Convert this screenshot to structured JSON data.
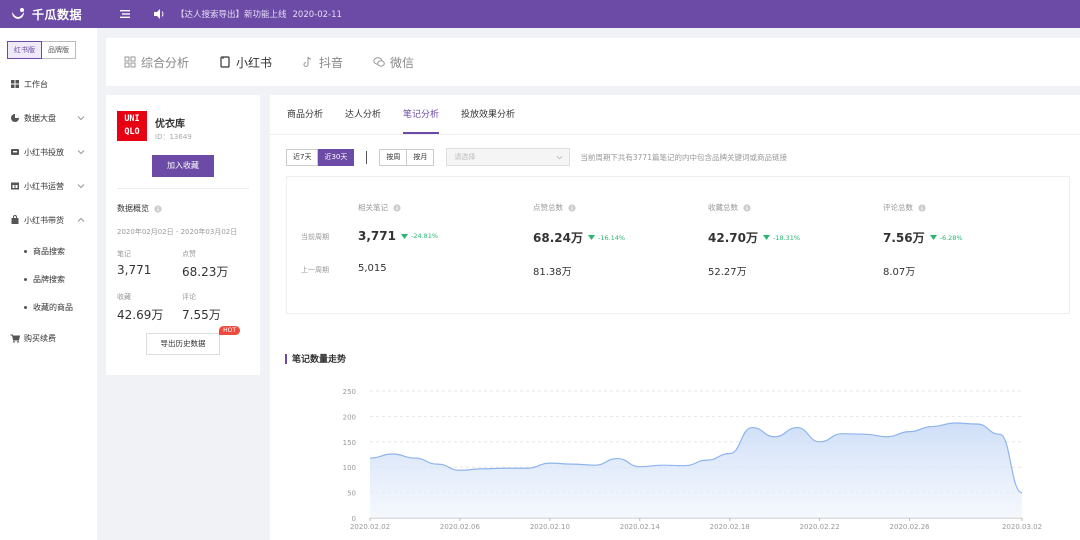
{
  "header": {
    "app_name": "千瓜数据",
    "notice": "【达人搜索导出】新功能上线",
    "notice_date": "2020-02-11"
  },
  "sidebar": {
    "version_tabs": [
      "红书版",
      "品牌版"
    ],
    "items": [
      {
        "label": "工作台",
        "icon": "grid-icon"
      },
      {
        "label": "数据大盘",
        "icon": "chart-circle-icon"
      },
      {
        "label": "小红书投放",
        "icon": "delivery-icon"
      },
      {
        "label": "小红书运营",
        "icon": "store-icon"
      },
      {
        "label": "小红书带货",
        "icon": "shopping-bag-icon"
      },
      {
        "label": "购买续费",
        "icon": "cart-icon"
      }
    ],
    "sub_items": [
      "商品搜索",
      "品牌搜索",
      "收藏的商品"
    ]
  },
  "main_tabs": [
    {
      "label": "综合分析",
      "icon": "grid-outline-icon"
    },
    {
      "label": "小红书",
      "icon": "note-icon"
    },
    {
      "label": "抖音",
      "icon": "tiktok-icon"
    },
    {
      "label": "微信",
      "icon": "wechat-icon"
    }
  ],
  "brand": {
    "logo_text": [
      "UNI",
      "QLO"
    ],
    "name": "优衣库",
    "id_text": "ID：13649",
    "favorite_label": "加入收藏",
    "overview_title": "数据概览",
    "period": "2020年02月02日 - 2020年03月02日",
    "stats": [
      {
        "label": "笔记",
        "value": "3,771"
      },
      {
        "label": "点赞",
        "value": "68.23万"
      },
      {
        "label": "收藏",
        "value": "42.69万"
      },
      {
        "label": "评论",
        "value": "7.55万"
      }
    ],
    "export_label": "导出历史数据",
    "hot_badge": "HOT"
  },
  "analysis": {
    "sub_tabs": [
      "商品分析",
      "达人分析",
      "笔记分析",
      "投放效果分析"
    ],
    "range_buttons": [
      "近7天",
      "近30天"
    ],
    "period_buttons": [
      "按周",
      "按月"
    ],
    "select_placeholder": "请选择",
    "filter_note": "当前周期下共有3771篇笔记的内中包含品牌关键词或商品链接",
    "row_labels": [
      "当前周期",
      "上一周期"
    ],
    "metrics": [
      {
        "title": "相关笔记",
        "current": "3,771",
        "change": "-24.81%",
        "previous": "5,015"
      },
      {
        "title": "点赞总数",
        "current": "68.24万",
        "change": "-16.14%",
        "previous": "81.38万"
      },
      {
        "title": "收藏总数",
        "current": "42.70万",
        "change": "-18.31%",
        "previous": "52.27万"
      },
      {
        "title": "评论总数",
        "current": "7.56万",
        "change": "-6.28%",
        "previous": "8.07万"
      }
    ],
    "chart_title": "笔记数量走势"
  },
  "colors": {
    "brand_purple": "#6b4ba5",
    "uniqlo_red": "#e60012",
    "decline_green": "#2bb673",
    "line_blue": "#8fb4ec"
  },
  "chart_data": {
    "type": "area",
    "title": "笔记数量走势",
    "ylim": [
      0,
      250
    ],
    "yticks": [
      0,
      50,
      100,
      150,
      200,
      250
    ],
    "x_tick_labels": [
      "2020.02.02",
      "2020.02.06",
      "2020.02.10",
      "2020.02.14",
      "2020.02.18",
      "2020.02.22",
      "2020.02.26",
      "2020.03.02"
    ],
    "x": [
      "2020.02.02",
      "2020.02.03",
      "2020.02.04",
      "2020.02.05",
      "2020.02.06",
      "2020.02.07",
      "2020.02.08",
      "2020.02.09",
      "2020.02.10",
      "2020.02.11",
      "2020.02.12",
      "2020.02.13",
      "2020.02.14",
      "2020.02.15",
      "2020.02.16",
      "2020.02.17",
      "2020.02.18",
      "2020.02.19",
      "2020.02.20",
      "2020.02.21",
      "2020.02.22",
      "2020.02.23",
      "2020.02.24",
      "2020.02.25",
      "2020.02.26",
      "2020.02.27",
      "2020.02.28",
      "2020.02.29",
      "2020.03.01",
      "2020.03.02"
    ],
    "values": [
      118,
      126,
      118,
      106,
      94,
      97,
      98,
      98,
      108,
      106,
      104,
      117,
      101,
      104,
      103,
      114,
      127,
      178,
      160,
      178,
      150,
      166,
      165,
      160,
      170,
      180,
      187,
      185,
      165,
      50
    ],
    "grid": true
  }
}
